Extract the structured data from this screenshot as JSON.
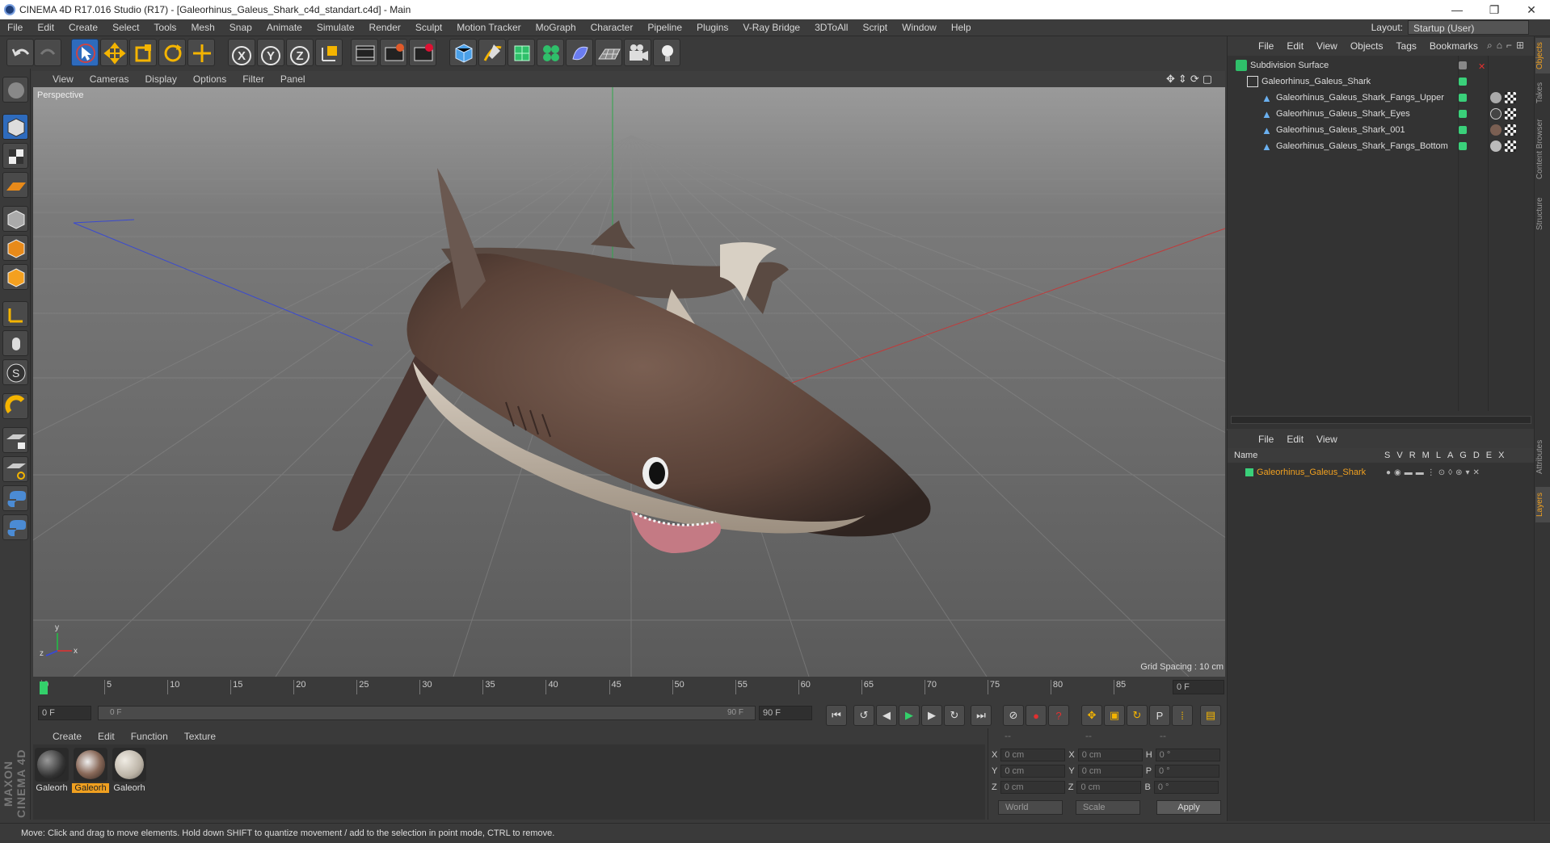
{
  "window": {
    "title": "CINEMA 4D R17.016 Studio (R17) - [Galeorhinus_Galeus_Shark_c4d_standart.c4d] - Main",
    "minimize": "—",
    "restore": "❐",
    "close": "✕"
  },
  "menubar": {
    "items": [
      "File",
      "Edit",
      "Create",
      "Select",
      "Tools",
      "Mesh",
      "Snap",
      "Animate",
      "Simulate",
      "Render",
      "Sculpt",
      "Motion Tracker",
      "MoGraph",
      "Character",
      "Pipeline",
      "Plugins",
      "V-Ray Bridge",
      "3DToAll",
      "Script",
      "Window",
      "Help"
    ],
    "layout_label": "Layout:",
    "layout_value": "Startup (User)"
  },
  "toolbar": {
    "axis_x": "X",
    "axis_y": "Y",
    "axis_z": "Z"
  },
  "viewport": {
    "menu": [
      "View",
      "Cameras",
      "Display",
      "Options",
      "Filter",
      "Panel"
    ],
    "label": "Perspective",
    "grid_spacing": "Grid Spacing : 10 cm"
  },
  "timeline": {
    "ticks": [
      "0",
      "5",
      "10",
      "15",
      "20",
      "25",
      "30",
      "35",
      "40",
      "45",
      "50",
      "55",
      "60",
      "65",
      "70",
      "75",
      "80",
      "85",
      "90"
    ],
    "current_frame": "0 F",
    "start_field": "0 F",
    "range_start": "0 F",
    "range_end": "90 F",
    "end_field": "90 F"
  },
  "materials": {
    "menu": [
      "Create",
      "Edit",
      "Function",
      "Texture"
    ],
    "items": [
      {
        "label": "Galeorh",
        "selected": false
      },
      {
        "label": "Galeorh",
        "selected": true
      },
      {
        "label": "Galeorh",
        "selected": false
      }
    ]
  },
  "coords": {
    "headers": [
      "--",
      "--",
      "--"
    ],
    "rows": [
      {
        "a": "X",
        "av": "0 cm",
        "b": "X",
        "bv": "0 cm",
        "c": "H",
        "cv": "0 °"
      },
      {
        "a": "Y",
        "av": "0 cm",
        "b": "Y",
        "bv": "0 cm",
        "c": "P",
        "cv": "0 °"
      },
      {
        "a": "Z",
        "av": "0 cm",
        "b": "Z",
        "bv": "0 cm",
        "c": "B",
        "cv": "0 °"
      }
    ],
    "mode": "World",
    "scale": "Scale",
    "apply": "Apply"
  },
  "status": "Move: Click and drag to move elements. Hold down SHIFT to quantize movement / add to the selection in point mode, CTRL to remove.",
  "objects": {
    "menu": [
      "File",
      "Edit",
      "View",
      "Objects",
      "Tags",
      "Bookmarks"
    ],
    "tree": [
      {
        "name": "Subdivision Surface",
        "indent": 0
      },
      {
        "name": "Galeorhinus_Galeus_Shark",
        "indent": 1
      },
      {
        "name": "Galeorhinus_Galeus_Shark_Fangs_Upper",
        "indent": 2
      },
      {
        "name": "Galeorhinus_Galeus_Shark_Eyes",
        "indent": 2
      },
      {
        "name": "Galeorhinus_Galeus_Shark_001",
        "indent": 2
      },
      {
        "name": "Galeorhinus_Galeus_Shark_Fangs_Bottom",
        "indent": 2
      }
    ]
  },
  "layers": {
    "menu": [
      "File",
      "Edit",
      "View"
    ],
    "header_name": "Name",
    "header_cols": [
      "S",
      "V",
      "R",
      "M",
      "L",
      "A",
      "G",
      "D",
      "E",
      "X"
    ],
    "rows": [
      {
        "name": "Galeorhinus_Galeus_Shark",
        "color": "#3ad07a"
      }
    ]
  },
  "right_tabs": [
    "Objects",
    "Takes",
    "Content Browser",
    "Structure",
    "Attributes",
    "Layers"
  ],
  "brand": "MAXON CINEMA 4D",
  "colors": {
    "accent_blue": "#2e6bbd",
    "selected_orange": "#f0a020",
    "layer_green": "#3ad07a"
  }
}
